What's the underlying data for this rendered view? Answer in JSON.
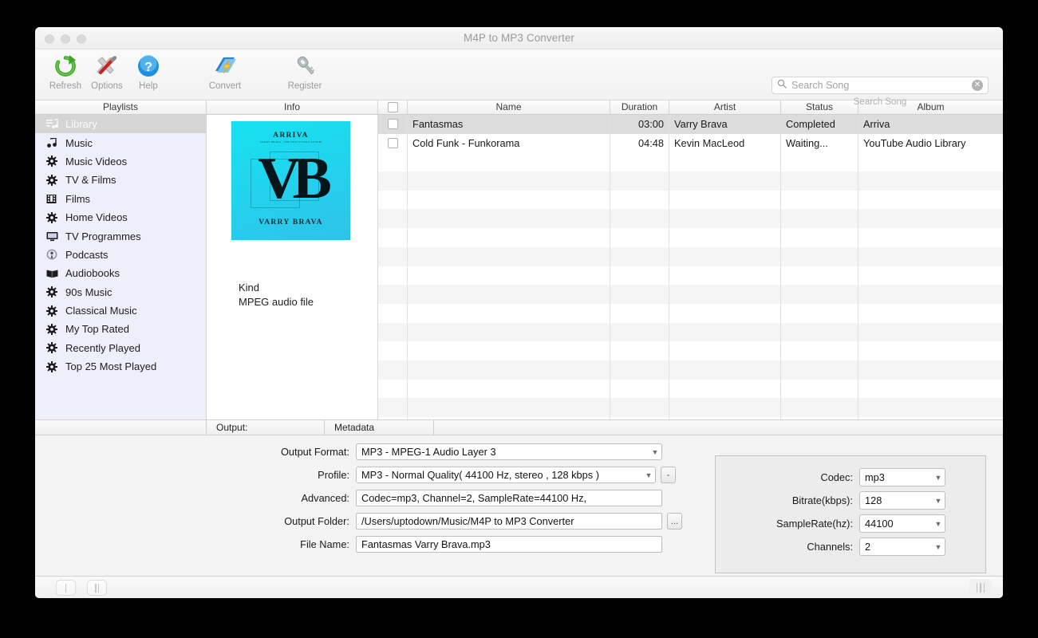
{
  "window": {
    "title": "M4P to MP3 Converter",
    "traffic_lights": [
      "close",
      "minimize",
      "zoom"
    ]
  },
  "toolbar": {
    "buttons": [
      {
        "label": "Refresh",
        "icon": "refresh-icon"
      },
      {
        "label": "Options",
        "icon": "options-icon"
      },
      {
        "label": "Help",
        "icon": "help-icon"
      },
      {
        "label": "Convert",
        "icon": "convert-icon"
      },
      {
        "label": "Register",
        "icon": "register-key-icon"
      }
    ],
    "search": {
      "placeholder": "Search Song",
      "value": "",
      "hint": "Search Song",
      "icon": "search-icon",
      "clear_icon": "clear-circle-icon"
    }
  },
  "panels": {
    "playlists_header": "Playlists",
    "info_header": "Info"
  },
  "sidebar": {
    "items": [
      {
        "label": "Library",
        "icon": "library-icon",
        "selected": true
      },
      {
        "label": "Music",
        "icon": "music-note-icon",
        "selected": false
      },
      {
        "label": "Music Videos",
        "icon": "gear-icon",
        "selected": false
      },
      {
        "label": "TV & Films",
        "icon": "gear-icon",
        "selected": false
      },
      {
        "label": "Films",
        "icon": "film-icon",
        "selected": false
      },
      {
        "label": "Home Videos",
        "icon": "gear-icon",
        "selected": false
      },
      {
        "label": "TV Programmes",
        "icon": "monitor-icon",
        "selected": false
      },
      {
        "label": "Podcasts",
        "icon": "podcast-icon",
        "selected": false
      },
      {
        "label": "Audiobooks",
        "icon": "book-icon",
        "selected": false
      },
      {
        "label": "90s Music",
        "icon": "gear-icon",
        "selected": false
      },
      {
        "label": "Classical Music",
        "icon": "gear-icon",
        "selected": false
      },
      {
        "label": "My Top Rated",
        "icon": "gear-icon",
        "selected": false
      },
      {
        "label": "Recently Played",
        "icon": "gear-icon",
        "selected": false
      },
      {
        "label": "Top 25 Most Played",
        "icon": "gear-icon",
        "selected": false
      }
    ]
  },
  "info": {
    "cover": {
      "top_text": "ARRIVA",
      "sub_text": "VARRY BRAVA · THE NEW STUDIO ALBUM",
      "monogram": "VB",
      "bottom_text": "VARRY BRAVA",
      "bg_color": "#19dcf0"
    },
    "kind_label": "Kind",
    "kind_value": "MPEG audio file"
  },
  "table": {
    "columns": [
      "",
      "Name",
      "Duration",
      "Artist",
      "Status",
      "Album"
    ],
    "rows": [
      {
        "checked": false,
        "name": "Fantasmas",
        "duration": "03:00",
        "artist": "Varry Brava",
        "status": "Completed",
        "status_color": "#4b2fe0",
        "album": "Arriva",
        "selected": true
      },
      {
        "checked": false,
        "name": "Cold Funk - Funkorama",
        "duration": "04:48",
        "artist": "Kevin MacLeod",
        "status": "Waiting...",
        "status_color": "#1a1a1a",
        "album": "YouTube Audio Library",
        "selected": false
      }
    ]
  },
  "bottom": {
    "tabs": [
      {
        "label": "Output:",
        "active": true
      },
      {
        "label": "Metadata",
        "active": false
      }
    ],
    "fields": [
      {
        "label": "Output Format:",
        "value": "MP3 - MPEG-1 Audio Layer 3",
        "type": "select"
      },
      {
        "label": "Profile:",
        "value": "MP3 - Normal Quality( 44100 Hz, stereo , 128 kbps )",
        "type": "select",
        "extra_button": "-"
      },
      {
        "label": "Advanced:",
        "value": "Codec=mp3, Channel=2, SampleRate=44100 Hz,",
        "type": "text"
      },
      {
        "label": "Output Folder:",
        "value": "/Users/uptodown/Music/M4P to MP3 Converter",
        "type": "text",
        "extra_button": "..."
      },
      {
        "label": "File Name:",
        "value": "Fantasmas Varry Brava.mp3",
        "type": "text"
      }
    ],
    "codec_panel": [
      {
        "label": "Codec:",
        "value": "mp3"
      },
      {
        "label": "Bitrate(kbps):",
        "value": "128"
      },
      {
        "label": "SampleRate(hz):",
        "value": "44100"
      },
      {
        "label": "Channels:",
        "value": "2"
      }
    ]
  },
  "statusbar": {
    "play_button": "play-pause-single-bar",
    "pause_button": "pause-double-bar",
    "resize_grip": "resize-grip-icon"
  }
}
